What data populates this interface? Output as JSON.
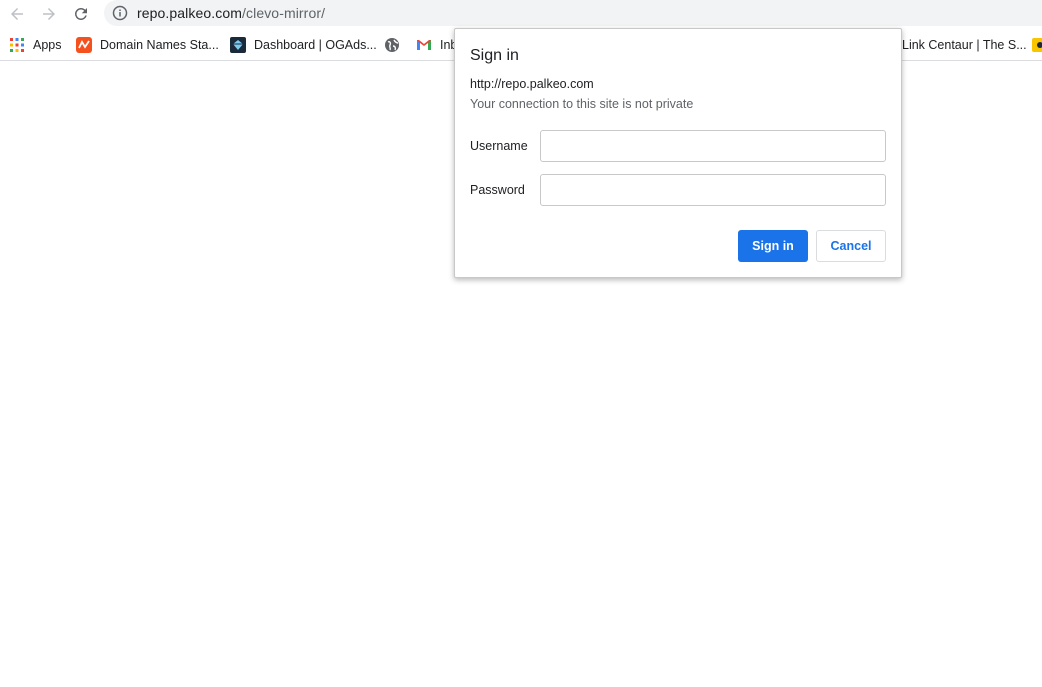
{
  "browser": {
    "url_host": "repo.palkeo.com",
    "url_path": "/clevo-mirror/",
    "icons": {
      "back": "arrow-left-icon",
      "forward": "arrow-right-icon",
      "reload": "reload-icon",
      "site_info": "info-icon"
    }
  },
  "bookmarks": [
    {
      "label": "Apps",
      "icon": "apps-grid-icon"
    },
    {
      "label": "Domain Names Sta...",
      "icon": "domain-favicon",
      "color": "#f4511e"
    },
    {
      "label": "Dashboard | OGAds...",
      "icon": "ogads-favicon",
      "color": "#1a2a3a"
    },
    {
      "label": "",
      "icon": "globe-icon"
    },
    {
      "label": "Inb",
      "icon": "gmail-icon"
    },
    {
      "label": "Link Centaur | The S...",
      "icon": ""
    },
    {
      "label": "",
      "icon": "edge-favicon",
      "color": "#f9c400"
    }
  ],
  "dialog": {
    "title": "Sign in",
    "origin": "http://repo.palkeo.com",
    "warning": "Your connection to this site is not private",
    "username_label": "Username",
    "password_label": "Password",
    "username_value": "",
    "password_value": "",
    "sign_in_label": "Sign in",
    "cancel_label": "Cancel",
    "accent_color": "#1a73e8"
  }
}
